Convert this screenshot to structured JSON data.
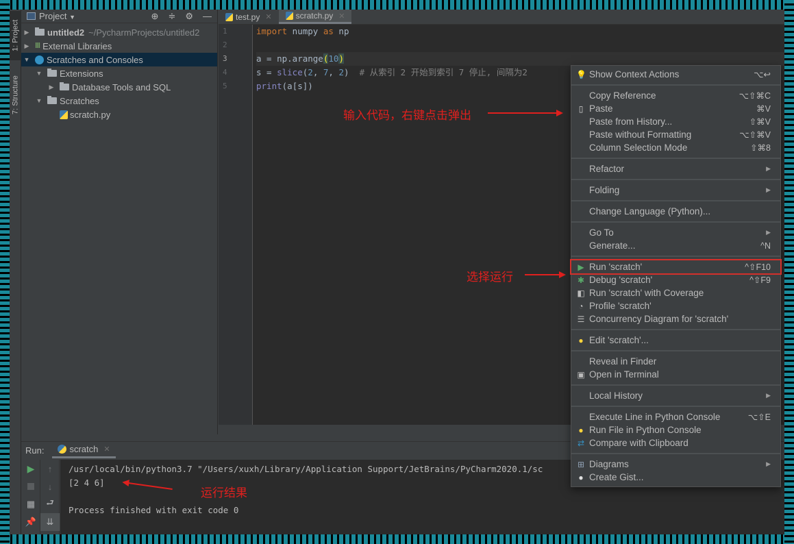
{
  "tool_stripe": {
    "project_tab": "1: Project",
    "structure_tab": "7: Structure"
  },
  "project_panel": {
    "title": "Project",
    "tree": [
      {
        "label": "untitled2",
        "path": "~/PycharmProjects/untitled2",
        "level": 0,
        "expanded": false,
        "icon": "folder-icon",
        "bold": true
      },
      {
        "label": "External Libraries",
        "level": 0,
        "expanded": false,
        "icon": "library-icon"
      },
      {
        "label": "Scratches and Consoles",
        "level": 0,
        "expanded": true,
        "icon": "scratches-icon",
        "selected": true
      },
      {
        "label": "Extensions",
        "level": 1,
        "expanded": true,
        "icon": "folder-icon"
      },
      {
        "label": "Database Tools and SQL",
        "level": 2,
        "expanded": false,
        "icon": "folder-icon"
      },
      {
        "label": "Scratches",
        "level": 1,
        "expanded": true,
        "icon": "folder-icon"
      },
      {
        "label": "scratch.py",
        "level": 2,
        "icon": "python-file-icon"
      }
    ]
  },
  "editor": {
    "tabs": [
      {
        "label": "test.py",
        "active": false
      },
      {
        "label": "scratch.py",
        "active": true
      }
    ],
    "line_numbers": [
      "1",
      "2",
      "3",
      "4",
      "5"
    ],
    "current_line": 3,
    "code_lines": [
      "import numpy as np",
      "",
      "a = np.arange(10)",
      "s = slice(2, 7, 2)  # 从索引 2 开始到索引 7 停止, 间隔为2",
      "print(a[s])"
    ]
  },
  "annotations": {
    "input_code": "输入代码，右键点击弹出",
    "select_run": "选择运行",
    "run_result": "运行结果",
    "color": "#e0201e"
  },
  "context_menu": {
    "groups": [
      [
        {
          "label": "Show Context Actions",
          "shortcut": "⌥↩",
          "icon": "lightbulb-icon"
        }
      ],
      [
        {
          "label": "Copy Reference",
          "shortcut": "⌥⇧⌘C"
        },
        {
          "label": "Paste",
          "shortcut": "⌘V",
          "icon": "clipboard-icon"
        },
        {
          "label": "Paste from History...",
          "shortcut": "⇧⌘V"
        },
        {
          "label": "Paste without Formatting",
          "shortcut": "⌥⇧⌘V"
        },
        {
          "label": "Column Selection Mode",
          "shortcut": "⇧⌘8"
        }
      ],
      [
        {
          "label": "Refactor",
          "submenu": true
        }
      ],
      [
        {
          "label": "Folding",
          "submenu": true
        }
      ],
      [
        {
          "label": "Change Language (Python)..."
        }
      ],
      [
        {
          "label": "Go To",
          "submenu": true
        },
        {
          "label": "Generate...",
          "shortcut": "^N"
        }
      ],
      [
        {
          "label": "Run 'scratch'",
          "shortcut": "^⇧F10",
          "icon": "run-icon",
          "highlighted": true
        },
        {
          "label": "Debug 'scratch'",
          "shortcut": "^⇧F9",
          "icon": "debug-icon"
        },
        {
          "label": "Run 'scratch' with Coverage",
          "icon": "coverage-icon"
        },
        {
          "label": "Profile 'scratch'",
          "icon": "profile-icon"
        },
        {
          "label": "Concurrency Diagram for 'scratch'",
          "icon": "concurrency-icon"
        }
      ],
      [
        {
          "label": "Edit 'scratch'...",
          "icon": "python-icon"
        }
      ],
      [
        {
          "label": "Reveal in Finder"
        },
        {
          "label": "Open in Terminal",
          "icon": "terminal-icon"
        }
      ],
      [
        {
          "label": "Local History",
          "submenu": true
        }
      ],
      [
        {
          "label": "Execute Line in Python Console",
          "shortcut": "⌥⇧E"
        },
        {
          "label": "Run File in Python Console",
          "icon": "python-icon"
        },
        {
          "label": "Compare with Clipboard",
          "icon": "compare-icon"
        }
      ],
      [
        {
          "label": "Diagrams",
          "submenu": true,
          "icon": "diagram-icon"
        },
        {
          "label": "Create Gist...",
          "icon": "github-icon"
        }
      ]
    ]
  },
  "run_panel": {
    "label": "Run:",
    "tab": "scratch",
    "console_lines": [
      "/usr/local/bin/python3.7 \"/Users/xuxh/Library/Application Support/JetBrains/PyCharm2020.1/sc",
      "[2 4 6]",
      "",
      "Process finished with exit code 0"
    ]
  }
}
